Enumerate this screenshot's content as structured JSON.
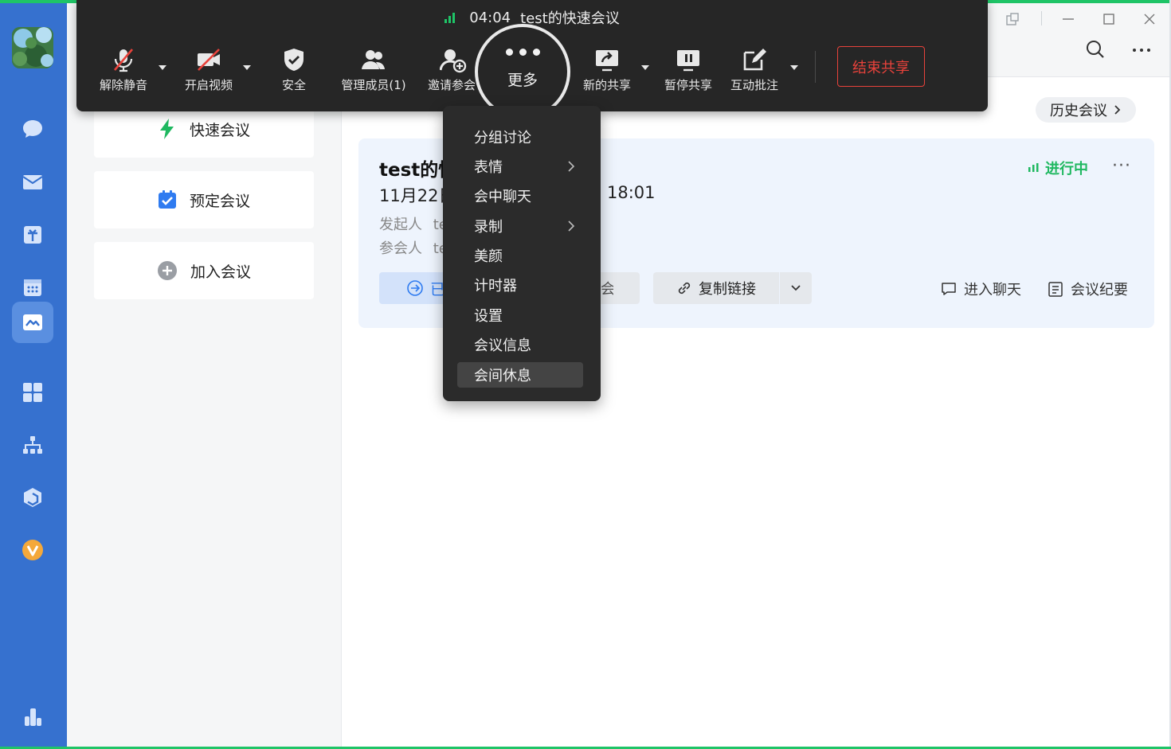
{
  "toolbar": {
    "timer": "04:04",
    "meeting_title": "test的快速会议",
    "unmute": "解除静音",
    "start_video": "开启视频",
    "security": "安全",
    "manage_members": "管理成员(1)",
    "invite": "邀请参会",
    "more": "更多",
    "new_share": "新的共享",
    "pause_share": "暂停共享",
    "annotate": "互动批注",
    "end_share": "结束共享"
  },
  "menu": {
    "items": [
      {
        "label": "分组讨论",
        "submenu": false
      },
      {
        "label": "表情",
        "submenu": true
      },
      {
        "label": "会中聊天",
        "submenu": false
      },
      {
        "label": "录制",
        "submenu": true
      },
      {
        "label": "美颜",
        "submenu": false
      },
      {
        "label": "计时器",
        "submenu": false
      },
      {
        "label": "设置",
        "submenu": false
      },
      {
        "label": "会议信息",
        "submenu": false
      },
      {
        "label": "会间休息",
        "submenu": false
      }
    ],
    "highlighted": "会间休息"
  },
  "actions": {
    "quick": "快速会议",
    "schedule": "预定会议",
    "join": "加入会议"
  },
  "main": {
    "history": "历史会议",
    "card": {
      "title": "test的快速会议",
      "date_start": "11月22日",
      "time_end": "18:01",
      "organizer_label": "发起人",
      "organizer_value": "test",
      "participants_label": "参会人",
      "participants_value": "test",
      "status": "进行中",
      "joined_label": "已",
      "copy_link": "复制链接",
      "enter_chat": "进入聊天",
      "minutes": "会议纪要",
      "partial_btn_tail": "会"
    }
  },
  "colors": {
    "nav_blue": "#3671cf",
    "accent_green": "#1fc467",
    "toolbar_bg": "#262626",
    "end_share_red": "#e8423b"
  }
}
